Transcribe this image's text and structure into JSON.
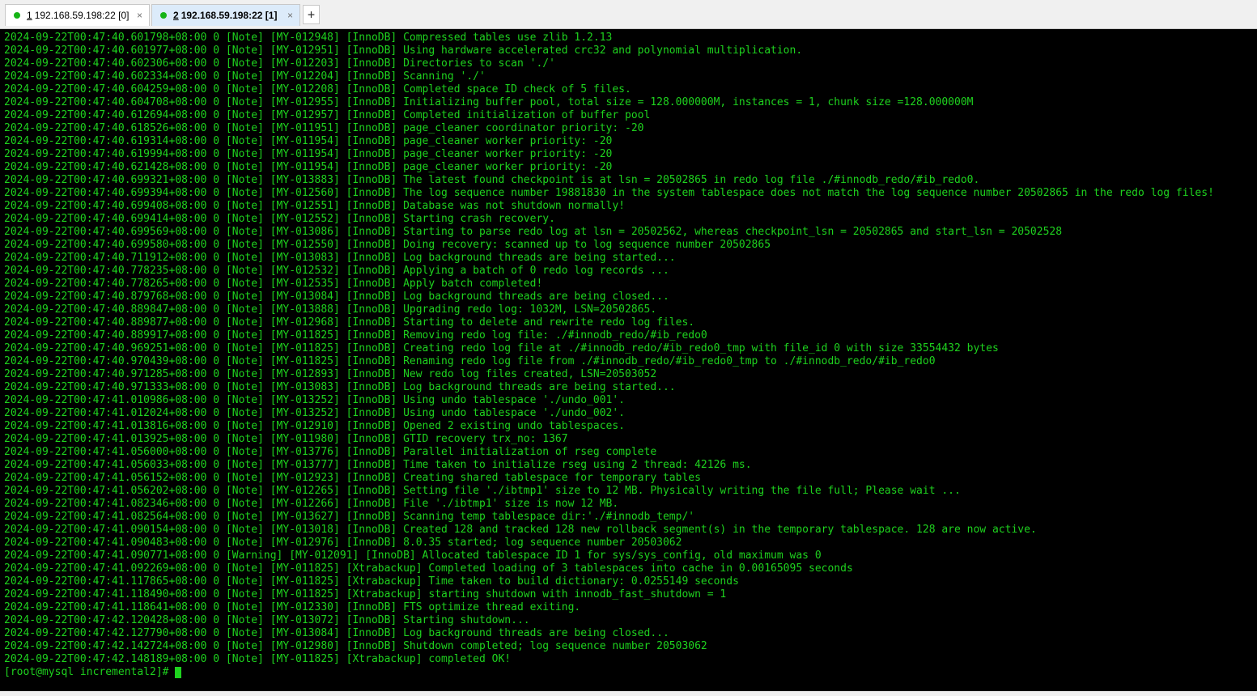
{
  "tabs": [
    {
      "number": "1",
      "label": "192.168.59.198:22 [0]",
      "status_color": "#16b416",
      "close_glyph": "×"
    },
    {
      "number": "2",
      "label": "192.168.59.198:22 [1]",
      "status_color": "#16b416",
      "close_glyph": "×"
    }
  ],
  "new_tab_glyph": "+",
  "terminal": {
    "lines": [
      "2024-09-22T00:47:40.601798+08:00 0 [Note] [MY-012948] [InnoDB] Compressed tables use zlib 1.2.13",
      "2024-09-22T00:47:40.601977+08:00 0 [Note] [MY-012951] [InnoDB] Using hardware accelerated crc32 and polynomial multiplication.",
      "2024-09-22T00:47:40.602306+08:00 0 [Note] [MY-012203] [InnoDB] Directories to scan './'",
      "2024-09-22T00:47:40.602334+08:00 0 [Note] [MY-012204] [InnoDB] Scanning './'",
      "2024-09-22T00:47:40.604259+08:00 0 [Note] [MY-012208] [InnoDB] Completed space ID check of 5 files.",
      "2024-09-22T00:47:40.604708+08:00 0 [Note] [MY-012955] [InnoDB] Initializing buffer pool, total size = 128.000000M, instances = 1, chunk size =128.000000M",
      "2024-09-22T00:47:40.612694+08:00 0 [Note] [MY-012957] [InnoDB] Completed initialization of buffer pool",
      "2024-09-22T00:47:40.618526+08:00 0 [Note] [MY-011951] [InnoDB] page_cleaner coordinator priority: -20",
      "2024-09-22T00:47:40.619314+08:00 0 [Note] [MY-011954] [InnoDB] page_cleaner worker priority: -20",
      "2024-09-22T00:47:40.619994+08:00 0 [Note] [MY-011954] [InnoDB] page_cleaner worker priority: -20",
      "2024-09-22T00:47:40.621428+08:00 0 [Note] [MY-011954] [InnoDB] page_cleaner worker priority: -20",
      "2024-09-22T00:47:40.699321+08:00 0 [Note] [MY-013883] [InnoDB] The latest found checkpoint is at lsn = 20502865 in redo log file ./#innodb_redo/#ib_redo0.",
      "2024-09-22T00:47:40.699394+08:00 0 [Note] [MY-012560] [InnoDB] The log sequence number 19881830 in the system tablespace does not match the log sequence number 20502865 in the redo log files!",
      "2024-09-22T00:47:40.699408+08:00 0 [Note] [MY-012551] [InnoDB] Database was not shutdown normally!",
      "2024-09-22T00:47:40.699414+08:00 0 [Note] [MY-012552] [InnoDB] Starting crash recovery.",
      "2024-09-22T00:47:40.699569+08:00 0 [Note] [MY-013086] [InnoDB] Starting to parse redo log at lsn = 20502562, whereas checkpoint_lsn = 20502865 and start_lsn = 20502528",
      "2024-09-22T00:47:40.699580+08:00 0 [Note] [MY-012550] [InnoDB] Doing recovery: scanned up to log sequence number 20502865",
      "2024-09-22T00:47:40.711912+08:00 0 [Note] [MY-013083] [InnoDB] Log background threads are being started...",
      "2024-09-22T00:47:40.778235+08:00 0 [Note] [MY-012532] [InnoDB] Applying a batch of 0 redo log records ...",
      "2024-09-22T00:47:40.778265+08:00 0 [Note] [MY-012535] [InnoDB] Apply batch completed!",
      "2024-09-22T00:47:40.879768+08:00 0 [Note] [MY-013084] [InnoDB] Log background threads are being closed...",
      "2024-09-22T00:47:40.889847+08:00 0 [Note] [MY-013888] [InnoDB] Upgrading redo log: 1032M, LSN=20502865.",
      "2024-09-22T00:47:40.889877+08:00 0 [Note] [MY-012968] [InnoDB] Starting to delete and rewrite redo log files.",
      "2024-09-22T00:47:40.889917+08:00 0 [Note] [MY-011825] [InnoDB] Removing redo log file: ./#innodb_redo/#ib_redo0",
      "2024-09-22T00:47:40.969251+08:00 0 [Note] [MY-011825] [InnoDB] Creating redo log file at ./#innodb_redo/#ib_redo0_tmp with file_id 0 with size 33554432 bytes",
      "2024-09-22T00:47:40.970439+08:00 0 [Note] [MY-011825] [InnoDB] Renaming redo log file from ./#innodb_redo/#ib_redo0_tmp to ./#innodb_redo/#ib_redo0",
      "2024-09-22T00:47:40.971285+08:00 0 [Note] [MY-012893] [InnoDB] New redo log files created, LSN=20503052",
      "2024-09-22T00:47:40.971333+08:00 0 [Note] [MY-013083] [InnoDB] Log background threads are being started...",
      "2024-09-22T00:47:41.010986+08:00 0 [Note] [MY-013252] [InnoDB] Using undo tablespace './undo_001'.",
      "2024-09-22T00:47:41.012024+08:00 0 [Note] [MY-013252] [InnoDB] Using undo tablespace './undo_002'.",
      "2024-09-22T00:47:41.013816+08:00 0 [Note] [MY-012910] [InnoDB] Opened 2 existing undo tablespaces.",
      "2024-09-22T00:47:41.013925+08:00 0 [Note] [MY-011980] [InnoDB] GTID recovery trx_no: 1367",
      "2024-09-22T00:47:41.056000+08:00 0 [Note] [MY-013776] [InnoDB] Parallel initialization of rseg complete",
      "2024-09-22T00:47:41.056033+08:00 0 [Note] [MY-013777] [InnoDB] Time taken to initialize rseg using 2 thread: 42126 ms.",
      "2024-09-22T00:47:41.056152+08:00 0 [Note] [MY-012923] [InnoDB] Creating shared tablespace for temporary tables",
      "2024-09-22T00:47:41.056202+08:00 0 [Note] [MY-012265] [InnoDB] Setting file './ibtmp1' size to 12 MB. Physically writing the file full; Please wait ...",
      "2024-09-22T00:47:41.082346+08:00 0 [Note] [MY-012266] [InnoDB] File './ibtmp1' size is now 12 MB.",
      "2024-09-22T00:47:41.082564+08:00 0 [Note] [MY-013627] [InnoDB] Scanning temp tablespace dir:'./#innodb_temp/'",
      "2024-09-22T00:47:41.090154+08:00 0 [Note] [MY-013018] [InnoDB] Created 128 and tracked 128 new rollback segment(s) in the temporary tablespace. 128 are now active.",
      "2024-09-22T00:47:41.090483+08:00 0 [Note] [MY-012976] [InnoDB] 8.0.35 started; log sequence number 20503062",
      "2024-09-22T00:47:41.090771+08:00 0 [Warning] [MY-012091] [InnoDB] Allocated tablespace ID 1 for sys/sys_config, old maximum was 0",
      "2024-09-22T00:47:41.092269+08:00 0 [Note] [MY-011825] [Xtrabackup] Completed loading of 3 tablespaces into cache in 0.00165095 seconds",
      "2024-09-22T00:47:41.117865+08:00 0 [Note] [MY-011825] [Xtrabackup] Time taken to build dictionary: 0.0255149 seconds",
      "2024-09-22T00:47:41.118490+08:00 0 [Note] [MY-011825] [Xtrabackup] starting shutdown with innodb_fast_shutdown = 1",
      "2024-09-22T00:47:41.118641+08:00 0 [Note] [MY-012330] [InnoDB] FTS optimize thread exiting.",
      "2024-09-22T00:47:42.120428+08:00 0 [Note] [MY-013072] [InnoDB] Starting shutdown...",
      "2024-09-22T00:47:42.127790+08:00 0 [Note] [MY-013084] [InnoDB] Log background threads are being closed...",
      "2024-09-22T00:47:42.142724+08:00 0 [Note] [MY-012980] [InnoDB] Shutdown completed; log sequence number 20503062",
      "2024-09-22T00:47:42.148189+08:00 0 [Note] [MY-011825] [Xtrabackup] completed OK!"
    ],
    "prompt": "[root@mysql incremental2]# ",
    "text_color": "#1ed21e",
    "background_color": "#000000"
  }
}
